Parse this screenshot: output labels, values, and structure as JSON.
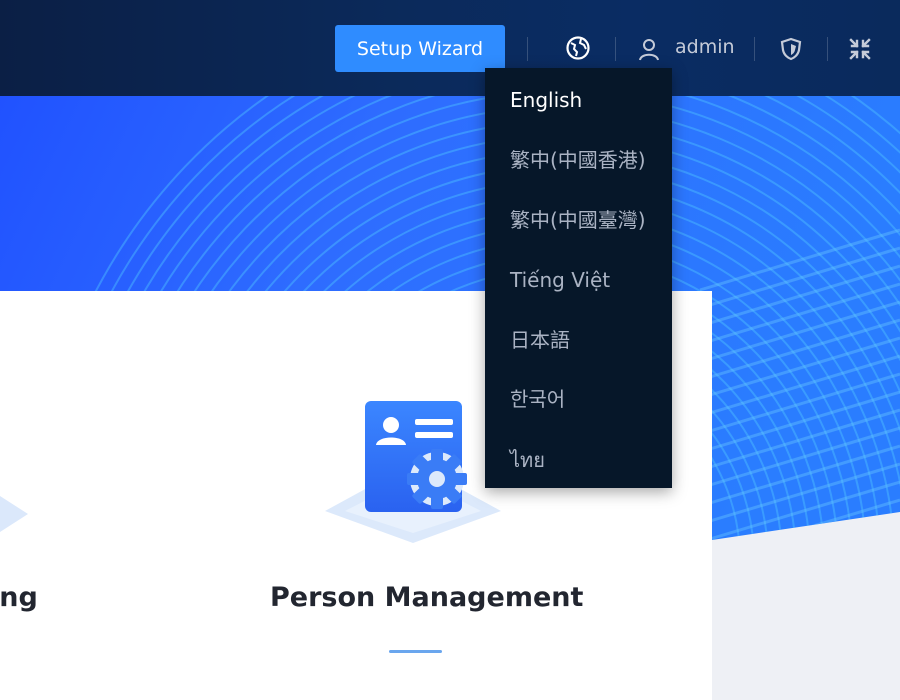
{
  "topbar": {
    "setup_wizard_label": "Setup Wizard",
    "user_name": "admin",
    "icons": [
      "globe-icon",
      "user-icon",
      "shield-icon",
      "exit-fullscreen-icon"
    ]
  },
  "language_menu": {
    "items": [
      {
        "label": "English",
        "active": true
      },
      {
        "label": "繁中(中國香港)",
        "active": false
      },
      {
        "label": "繁中(中國臺灣)",
        "active": false
      },
      {
        "label": "Tiếng Việt",
        "active": false
      },
      {
        "label": "日本語",
        "active": false
      },
      {
        "label": "한국어",
        "active": false
      },
      {
        "label": "ไทย",
        "active": false
      }
    ]
  },
  "cards": {
    "left_partial_title": "ing",
    "person_management_title": "Person Management"
  },
  "colors": {
    "accent_blue": "#2f8cff",
    "topbar_bg": "#0b2a5b",
    "menu_bg": "#061729",
    "hero_blue": "#2266ff"
  }
}
